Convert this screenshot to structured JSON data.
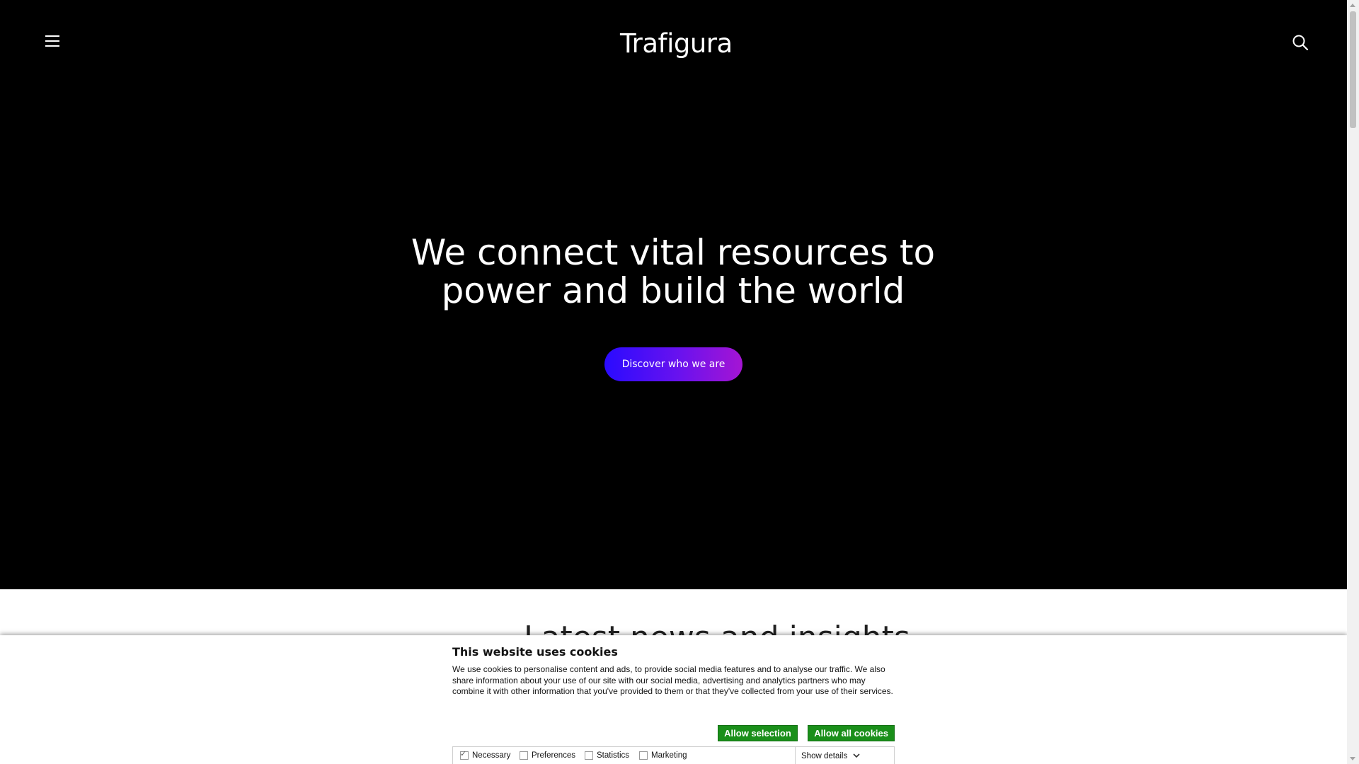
{
  "header": {
    "logo_text": "Trafigura",
    "menu_icon": "hamburger-menu-icon",
    "search_icon": "search-icon"
  },
  "hero": {
    "headline_line1": "We connect vital resources to",
    "headline_line2": "power and build the world",
    "cta_label": "Discover who we are",
    "cta_colors": [
      "#2a0bff",
      "#a515d3"
    ]
  },
  "section_peek_text": "Latest news and insights",
  "cookie_banner": {
    "title": "This website uses cookies",
    "body": "We use cookies to personalise content and ads, to provide social media features and to analyse our traffic. We also share information about your use of our site with our social media, advertising and analytics partners who may combine it with other information that you've provided to them or that they've collected from your use of their services.",
    "allow_selection": "Allow selection",
    "allow_all": "Allow all cookies",
    "button_color": "#1a8f1a",
    "options": [
      {
        "label": "Necessary",
        "checked": true
      },
      {
        "label": "Preferences",
        "checked": false
      },
      {
        "label": "Statistics",
        "checked": false
      },
      {
        "label": "Marketing",
        "checked": false
      }
    ],
    "show_details": "Show details"
  }
}
